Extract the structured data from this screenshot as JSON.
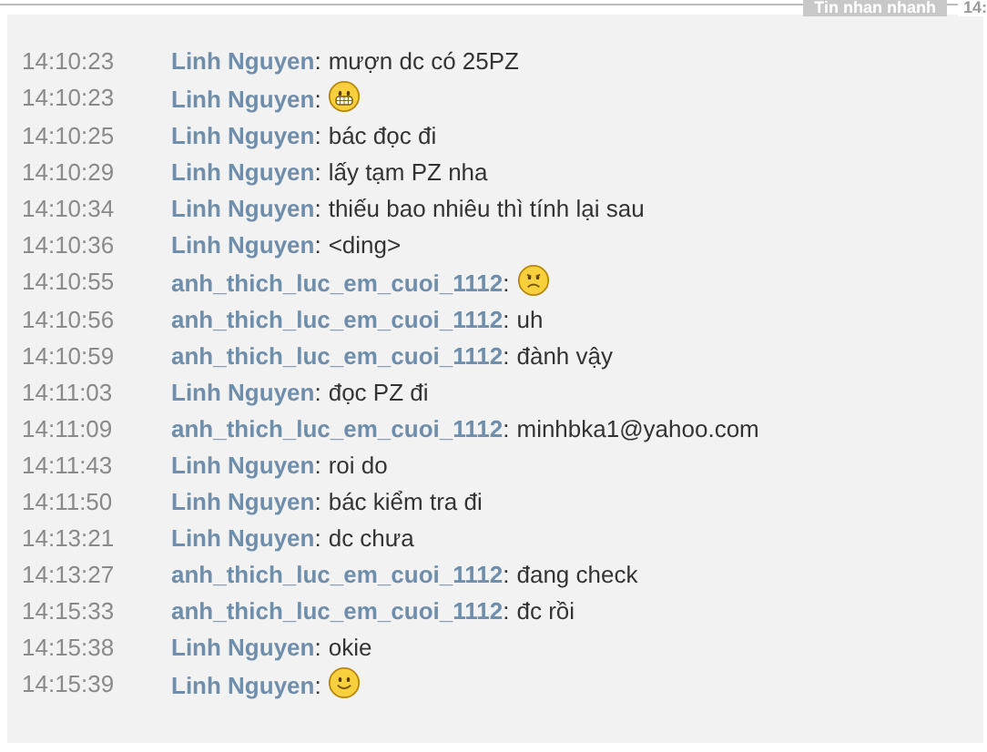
{
  "header": {
    "label": "Tin nhan nhanh",
    "time": "14:"
  },
  "messages": [
    {
      "time": "14:10:23",
      "sender": "Linh Nguyen",
      "separator": ":",
      "kind": "text",
      "text": "mượn dc có 25PZ"
    },
    {
      "time": "14:10:23",
      "sender": "Linh Nguyen",
      "separator": ":",
      "kind": "grin"
    },
    {
      "time": "14:10:25",
      "sender": "Linh Nguyen",
      "separator": ":",
      "kind": "text",
      "text": "bác đọc đi"
    },
    {
      "time": "14:10:29",
      "sender": "Linh Nguyen",
      "separator": ":",
      "kind": "text",
      "text": "lấy tạm PZ nha"
    },
    {
      "time": "14:10:34",
      "sender": "Linh Nguyen",
      "separator": ":",
      "kind": "text",
      "text": "thiếu bao nhiêu thì tính lại sau"
    },
    {
      "time": "14:10:36",
      "sender": "Linh Nguyen",
      "separator": ":",
      "kind": "text",
      "text": "<ding>"
    },
    {
      "time": "14:10:55",
      "sender": "anh_thich_luc_em_cuoi_1112",
      "separator": ":",
      "kind": "frown"
    },
    {
      "time": "14:10:56",
      "sender": "anh_thich_luc_em_cuoi_1112",
      "separator": ":",
      "kind": "text",
      "text": "uh"
    },
    {
      "time": "14:10:59",
      "sender": "anh_thich_luc_em_cuoi_1112",
      "separator": ":",
      "kind": "text",
      "text": "đành vậy"
    },
    {
      "time": "14:11:03",
      "sender": "Linh Nguyen",
      "separator": ":",
      "kind": "text",
      "text": "đọc PZ đi"
    },
    {
      "time": "14:11:09",
      "sender": "anh_thich_luc_em_cuoi_1112",
      "separator": ":",
      "kind": "text",
      "text": "minhbka1@yahoo.com"
    },
    {
      "time": "14:11:43",
      "sender": "Linh Nguyen",
      "separator": ":",
      "kind": "text",
      "text": "roi do"
    },
    {
      "time": "14:11:50",
      "sender": "Linh Nguyen",
      "separator": ":",
      "kind": "text",
      "text": "bác kiểm tra đi"
    },
    {
      "time": "14:13:21",
      "sender": "Linh Nguyen",
      "separator": ":",
      "kind": "text",
      "text": "dc chưa"
    },
    {
      "time": "14:13:27",
      "sender": "anh_thich_luc_em_cuoi_1112",
      "separator": ":",
      "kind": "text",
      "text": "đang check"
    },
    {
      "time": "14:15:33",
      "sender": "anh_thich_luc_em_cuoi_1112",
      "separator": ":",
      "kind": "text",
      "text": "đc rồi"
    },
    {
      "time": "14:15:38",
      "sender": "Linh Nguyen",
      "separator": ":",
      "kind": "text",
      "text": "okie"
    },
    {
      "time": "14:15:39",
      "sender": "Linh Nguyen",
      "separator": ":",
      "kind": "smile"
    }
  ]
}
